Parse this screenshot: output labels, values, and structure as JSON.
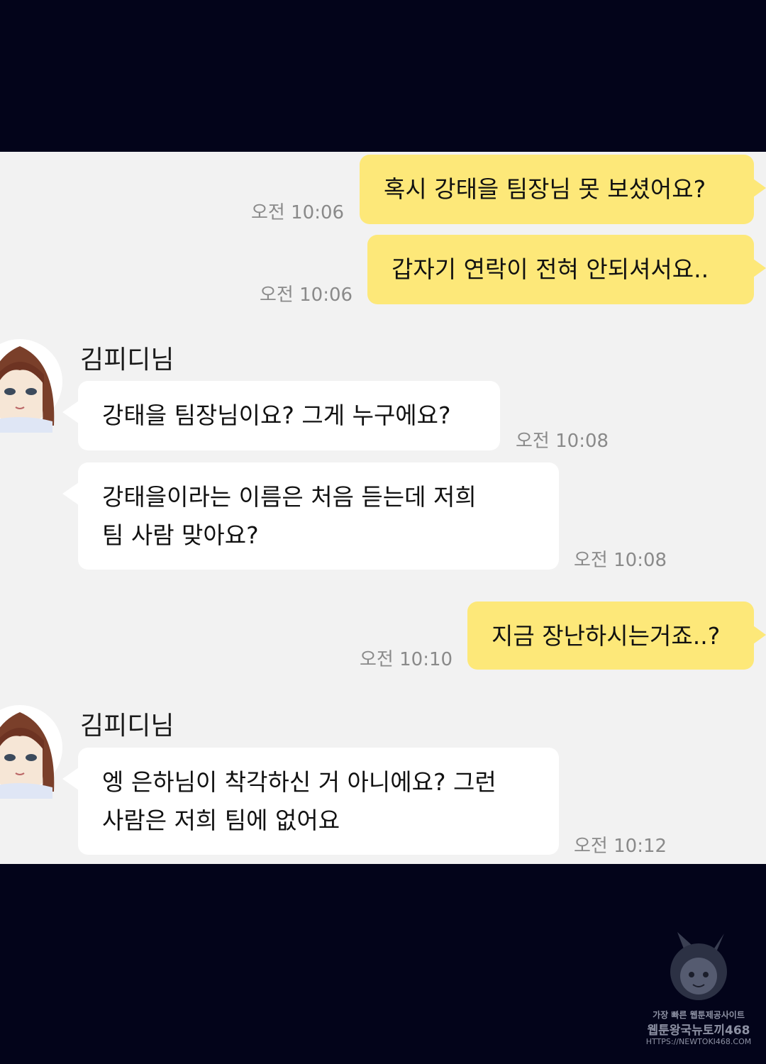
{
  "messages": [
    {
      "from": "me",
      "lines": [
        "혹시 강태을 팀장님 못 보셨어요?"
      ],
      "time": "오전 10:06"
    },
    {
      "from": "me",
      "lines": [
        "갑자기 연락이 전혀 안되셔서요.."
      ],
      "time": "오전 10:06"
    },
    {
      "from": "them",
      "sender": "김피디님",
      "lines": [
        "강태을 팀장님이요? 그게 누구에요?"
      ],
      "time": "오전 10:08"
    },
    {
      "from": "them",
      "lines": [
        "강태을이라는 이름은 처음 듣는데 저희",
        "팀 사람 맞아요?"
      ],
      "time": "오전 10:08"
    },
    {
      "from": "me",
      "lines": [
        "지금 장난하시는거죠..?"
      ],
      "time": "오전 10:10"
    },
    {
      "from": "them",
      "sender": "김피디님",
      "lines": [
        "엥 은하님이 착각하신 거 아니에요? 그런",
        "사람은 저희 팀에 없어요"
      ],
      "time": "오전 10:12"
    }
  ],
  "colors": {
    "my_bubble": "#fde879",
    "their_bubble": "#ffffff",
    "chat_background": "#f2f2f2",
    "outer_background": "#03041a"
  },
  "icons": {
    "avatar": "avatar-portrait-icon",
    "watermark": "rabbit-girl-mascot-icon"
  },
  "watermark": {
    "line1": "가장 빠른 웹툰제공사이트",
    "line2": "웹툰왕국뉴토끼468",
    "line3": "HTTPS://NEWTOKI468.COM"
  }
}
